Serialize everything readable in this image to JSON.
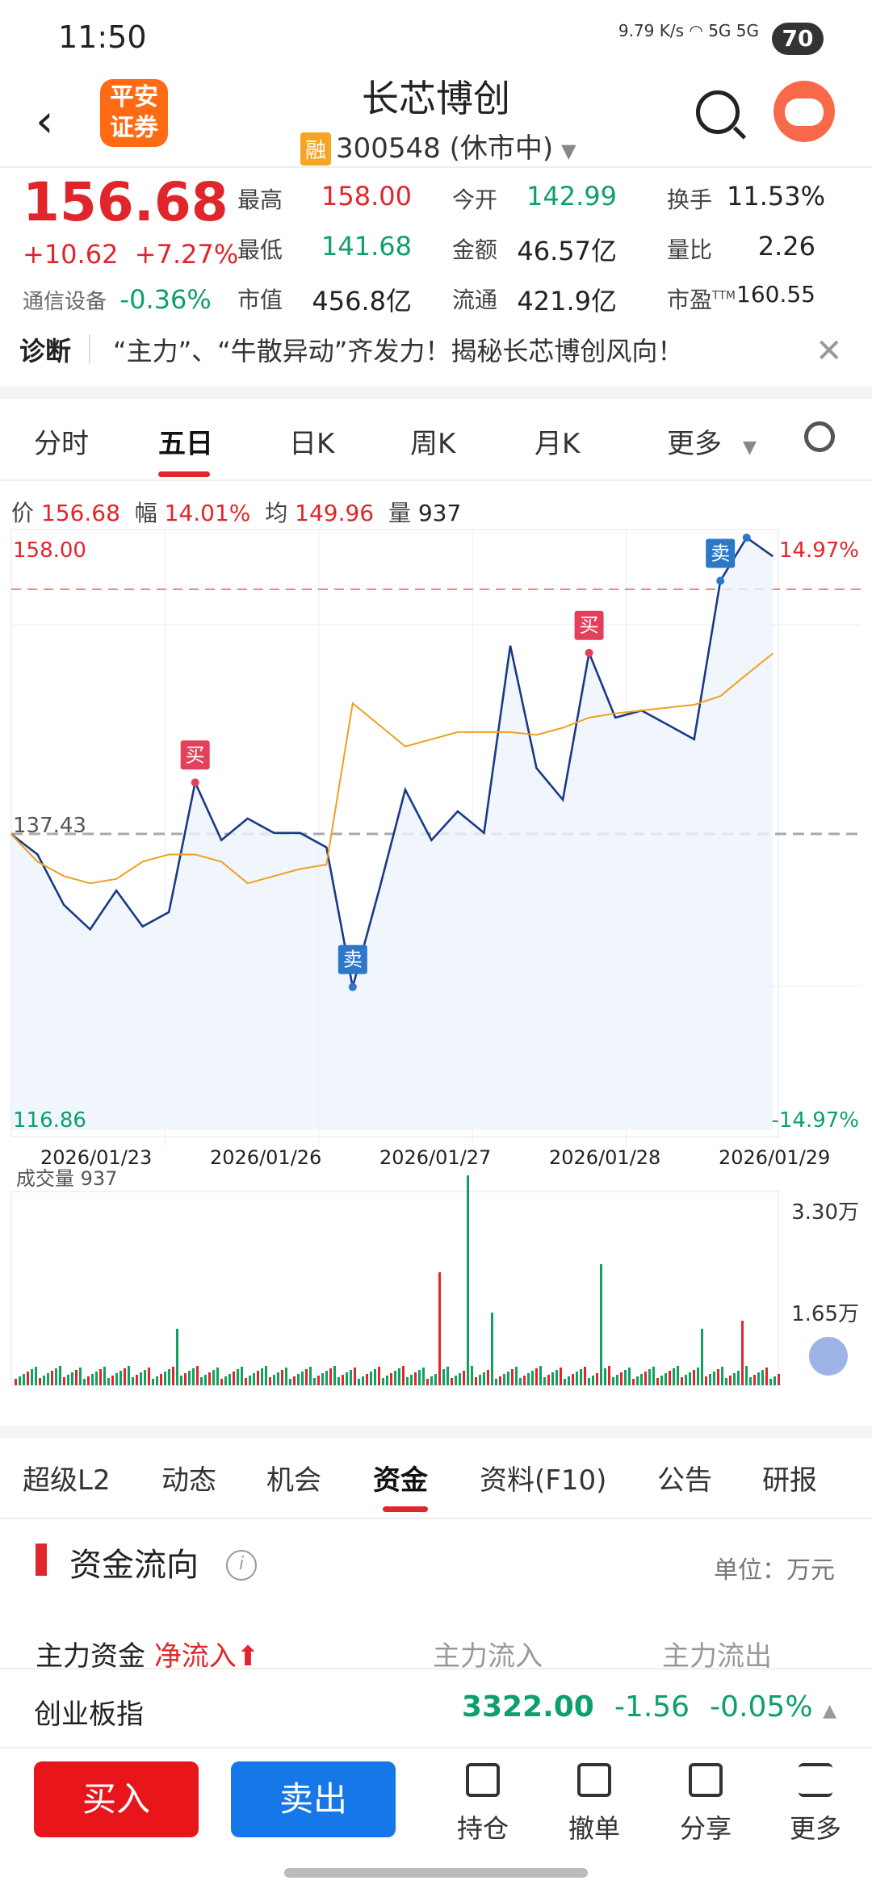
{
  "status_bar": {
    "time": "11:50",
    "net_speed": "9.79 K/s",
    "signal": "5G 5G",
    "battery": "70"
  },
  "header": {
    "broker_logo": "平安证券",
    "stock_name": "长芯博创",
    "margin_badge": "融",
    "code_status": "300548 (休市中)"
  },
  "quote": {
    "price": "156.68",
    "change": "+10.62",
    "change_pct": "+7.27%",
    "industry": "通信设备",
    "industry_pct": "-0.36%",
    "fields": [
      {
        "label": "最高",
        "value": "158.00",
        "color": "red"
      },
      {
        "label": "今开",
        "value": "142.99",
        "color": "green"
      },
      {
        "label": "换手",
        "value": "11.53%",
        "color": "black"
      },
      {
        "label": "最低",
        "value": "141.68",
        "color": "green"
      },
      {
        "label": "金额",
        "value": "46.57亿",
        "color": "black"
      },
      {
        "label": "量比",
        "value": "2.26",
        "color": "black"
      },
      {
        "label": "市值",
        "value": "456.8亿",
        "color": "black"
      },
      {
        "label": "流通",
        "value": "421.9亿",
        "color": "black"
      },
      {
        "label": "市盈",
        "value": "160.55",
        "color": "black",
        "sup": "TTM"
      }
    ]
  },
  "diagnosis": {
    "label": "诊断",
    "text": "“主力”、“牛散异动”齐发力！揭秘长芯博创风向！"
  },
  "period_tabs": [
    "分时",
    "五日",
    "日K",
    "周K",
    "月K",
    "更多"
  ],
  "active_period": "五日",
  "chart_info": {
    "price_label": "价",
    "price": "156.68",
    "range_label": "幅",
    "range": "14.01%",
    "avg_label": "均",
    "avg": "149.96",
    "vol_label": "量",
    "vol": "937"
  },
  "chart_data": {
    "type": "line",
    "x": [
      "2026/01/23",
      "2026/01/26",
      "2026/01/27",
      "2026/01/28",
      "2026/01/29"
    ],
    "ylim": [
      116.86,
      158.0
    ],
    "y_left_ticks": [
      "158.00",
      "137.43",
      "116.86"
    ],
    "y_right_ticks": [
      "14.97%",
      "-14.97%"
    ],
    "reference_price": "137.43",
    "series": [
      {
        "values": [
          137.4,
          136.0,
          132.5,
          130.8,
          133.5,
          131.0,
          132.0,
          141.0,
          137.0,
          138.5,
          137.5,
          137.5,
          136.5,
          126.8,
          133.5,
          140.5,
          137.0,
          139.0,
          137.5,
          150.5,
          142.0,
          139.8,
          150.0,
          145.5,
          146.0,
          145.0,
          144.0,
          155.0,
          158.0,
          156.7
        ],
        "color": "#1a3a86"
      },
      {
        "values": [
          137.4,
          135.5,
          134.5,
          134.0,
          134.3,
          135.5,
          136.0,
          136.0,
          135.5,
          134.0,
          134.5,
          135.0,
          135.3,
          146.5,
          145.0,
          143.5,
          144.0,
          144.5,
          144.5,
          144.5,
          144.3,
          144.8,
          145.5,
          145.8,
          146.0,
          146.2,
          146.4,
          147.0,
          148.5,
          149.96
        ],
        "color": "#f0a020"
      }
    ],
    "markers": [
      "买",
      "卖",
      "买",
      "卖",
      "卖"
    ]
  },
  "volume": {
    "label": "成交量",
    "value": "937",
    "ticks": [
      "3.30万",
      "1.65万"
    ]
  },
  "bottom_tabs": [
    "超级L2",
    "动态",
    "机会",
    "资金",
    "资料(F10)",
    "公告",
    "研报"
  ],
  "active_bottom_tab": "资金",
  "fund_flow": {
    "title": "资金流向",
    "unit": "单位：万元",
    "main_label": "主力资金",
    "net_inflow": "净流入",
    "inflow_label": "主力流入",
    "outflow_label": "主力流出"
  },
  "index_ticker": {
    "name": "创业板指",
    "value": "3322.00",
    "change": "-1.56",
    "pct": "-0.05%"
  },
  "actions": {
    "buy": "买入",
    "sell": "卖出",
    "items": [
      "持仓",
      "撤单",
      "分享",
      "更多"
    ]
  },
  "colors": {
    "up": "#e0262b",
    "down": "#0e9f6e",
    "price_line": "#1a3a86",
    "avg_line": "#f0a020",
    "buy_btn": "#e8151b",
    "sell_btn": "#1677e8"
  }
}
